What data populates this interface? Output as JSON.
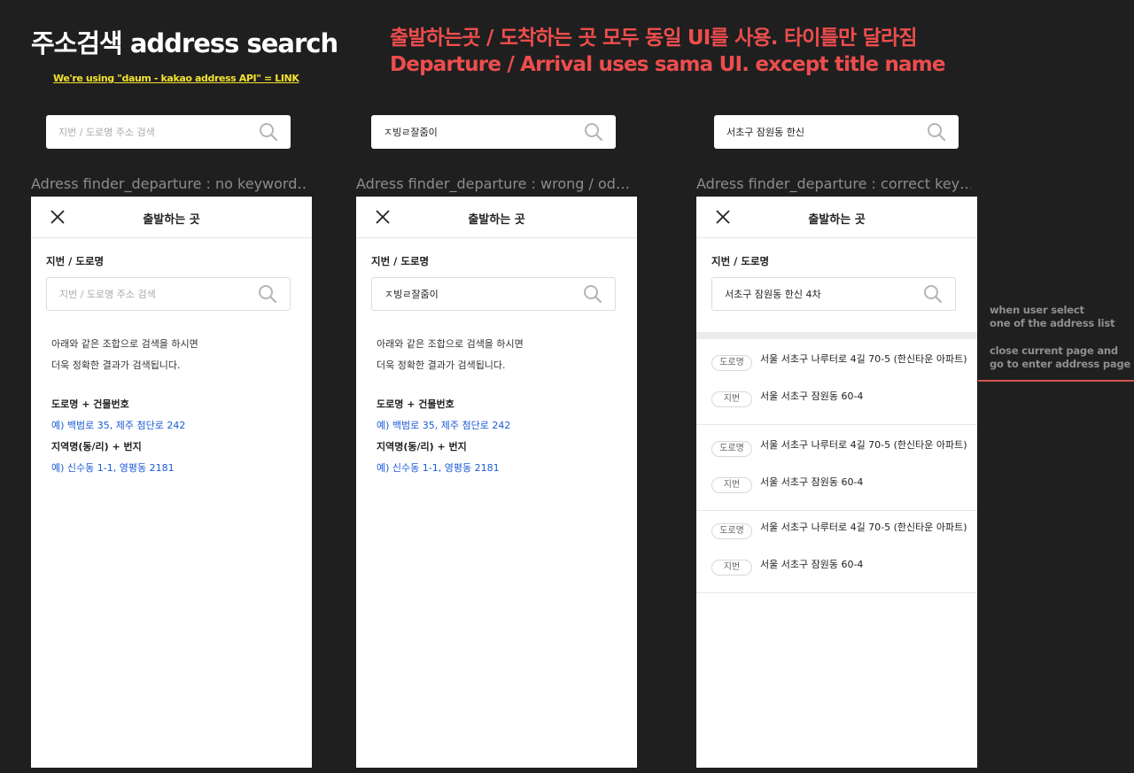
{
  "header": {
    "title": "주소검색 address search",
    "api_note": "We're using \"daum - kakao address API\" = LINK",
    "note_ko": "출발하는곳 / 도착하는 곳 모두 동일 UI를 사용. 타이틀만 달라짐",
    "note_en": "Departure / Arrival uses sama UI. except title name"
  },
  "colors": {
    "background": "#1f1f1f",
    "accent_red": "#ee4d4d",
    "link_yellow": "#f2e230",
    "example_blue": "#1a5bd6"
  },
  "screens": [
    {
      "top_search": {
        "value": "",
        "placeholder": "지번 / 도로명 주소 검색"
      },
      "label": "Adress finder_departure : no keyword…",
      "header_title": "출발하는 곳",
      "section_label": "지번 / 도로명",
      "search": {
        "value": "",
        "placeholder": "지번 / 도로명 주소 검색"
      }
    },
    {
      "top_search": {
        "value": "ㅈ빙ㄹ잘줌이",
        "placeholder": ""
      },
      "label": "Adress finder_departure : wrong / od…",
      "header_title": "출발하는 곳",
      "section_label": "지번 / 도로명",
      "search": {
        "value": "ㅈ빙ㄹ잘줌이",
        "placeholder": ""
      }
    },
    {
      "top_search": {
        "value": "서초구 잠원동 한신",
        "placeholder": ""
      },
      "label": "Adress finder_departure : correct key…",
      "header_title": "출발하는 곳",
      "section_label": "지번 / 도로명",
      "search": {
        "value": "서초구 잠원동 한신 4차",
        "placeholder": ""
      }
    }
  ],
  "guide": {
    "line1": "아래와 같은 조합으로 검색을 하시면",
    "line2": "더욱 정확한 결과가 검색됩니다.",
    "road_title": "도로명 + 건물번호",
    "road_example": "예) 백범로 35, 제주 첨단로 242",
    "region_title": "지역명(동/리) + 번지",
    "region_example": "예) 신수동 1-1, 영평동 2181"
  },
  "results": [
    {
      "road_tag": "도로명",
      "road": "서울 서초구 나루터로 4길 70-5 (한신타운 아파트)",
      "jibun_tag": "지번",
      "jibun": "서울 서초구 잠원동 60-4"
    },
    {
      "road_tag": "도로명",
      "road": "서울 서초구 나루터로 4길 70-5 (한신타운 아파트)",
      "jibun_tag": "지번",
      "jibun": "서울 서초구 잠원동 60-4"
    },
    {
      "road_tag": "도로명",
      "road": "서울 서초구 나루터로 4길 70-5 (한신타운 아파트)",
      "jibun_tag": "지번",
      "jibun": "서울 서초구 잠원동 60-4"
    }
  ],
  "side_note": {
    "line1": "when user select",
    "line2": "one of the address list",
    "line3": "close current page and",
    "line4": "go to enter address page"
  }
}
